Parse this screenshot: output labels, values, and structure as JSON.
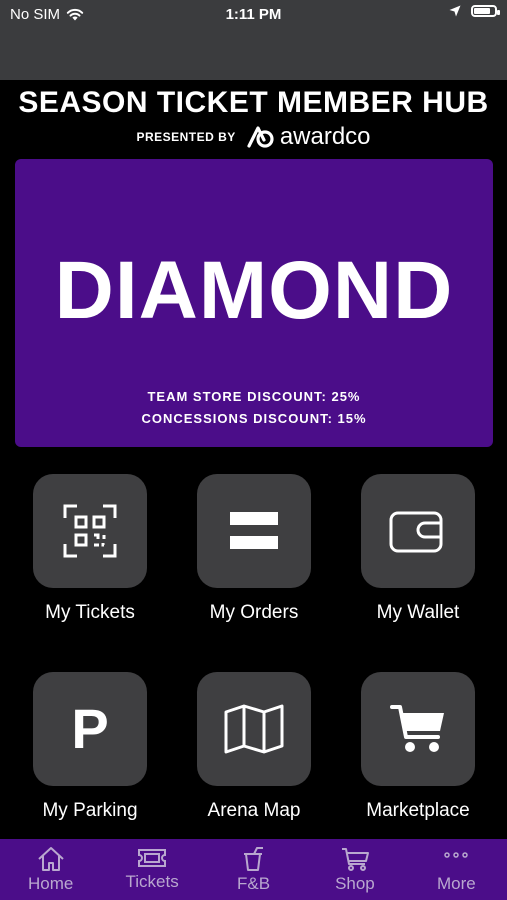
{
  "status_bar": {
    "carrier": "No SIM",
    "time": "1:11 PM",
    "battery_level": 0.8
  },
  "header": {
    "title": "SEASON TICKET MEMBER HUB",
    "presented_by": "PRESENTED BY",
    "brand": "awardco"
  },
  "tier_card": {
    "tier": "DIAMOND",
    "team_store_discount": "TEAM STORE DISCOUNT: 25%",
    "concessions_discount": "CONCESSIONS DISCOUNT: 15%",
    "color": "#4b0d89"
  },
  "tiles": [
    {
      "label": "My Tickets",
      "icon": "qr-code-icon"
    },
    {
      "label": "My Orders",
      "icon": "orders-icon"
    },
    {
      "label": "My Wallet",
      "icon": "wallet-icon"
    },
    {
      "label": "My Parking",
      "icon": "parking-icon"
    },
    {
      "label": "Arena Map",
      "icon": "map-icon"
    },
    {
      "label": "Marketplace",
      "icon": "cart-icon"
    }
  ],
  "tab_bar": {
    "items": [
      {
        "label": "Home",
        "icon": "home-icon"
      },
      {
        "label": "Tickets",
        "icon": "ticket-icon"
      },
      {
        "label": "F&B",
        "icon": "drink-icon"
      },
      {
        "label": "Shop",
        "icon": "cart-icon"
      },
      {
        "label": "More",
        "icon": "more-icon"
      }
    ],
    "color": "#4b0d89"
  }
}
